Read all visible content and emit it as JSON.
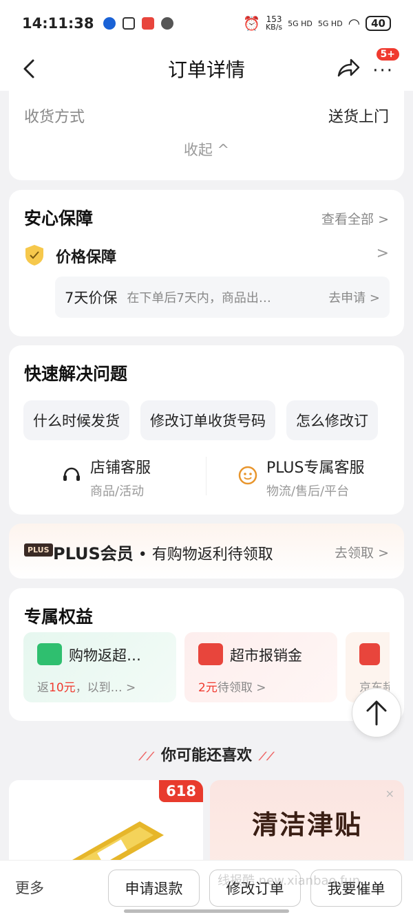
{
  "status_bar": {
    "time": "14:11:38",
    "net_speed_value": "153",
    "net_speed_unit": "KB/s",
    "sim1": "5G HD",
    "sim2": "5G HD",
    "battery": "40"
  },
  "nav": {
    "title": "订单详情",
    "badge": "5+",
    "more": "···"
  },
  "delivery": {
    "label": "收货方式",
    "value": "送货上门",
    "collapse": "收起 ^"
  },
  "guarantee": {
    "title": "安心保障",
    "view_all": "查看全部 >",
    "item_title": "价格保障",
    "chevron": ">",
    "sub_name": "7天价保",
    "sub_desc": "在下单后7天内，商品出…",
    "sub_action": "去申请 >"
  },
  "quick": {
    "title": "快速解决问题",
    "chips": [
      "什么时候发货",
      "修改订单收货号码",
      "怎么修改订"
    ],
    "store_service": {
      "name": "店铺客服",
      "sub": "商品/活动"
    },
    "plus_service": {
      "name": "PLUS专属客服",
      "sub": "物流/售后/平台"
    }
  },
  "plus": {
    "tag": "PLUS",
    "brand": "PLUS会员",
    "text": " • 有购物返利待领取",
    "action": "去领取 >"
  },
  "benefits": {
    "title": "专属权益",
    "items": [
      {
        "title": "购物返超…",
        "sub_prefix": "返",
        "sub_amount": "10元",
        "sub_suffix": "，以到… >"
      },
      {
        "title": "超市报销金",
        "sub_prefix": "",
        "sub_amount": "2元",
        "sub_suffix": "待领取 >"
      },
      {
        "title": "",
        "sub": "京东超"
      }
    ]
  },
  "may_like": {
    "title": "你可能还喜欢"
  },
  "products": [
    {
      "tag": "618"
    },
    {
      "promo": "清洁津贴",
      "close": "×"
    }
  ],
  "watermark": "线报酷 new.xianbao.fun",
  "bottom": {
    "more": "更多",
    "refund": "申请退款",
    "modify": "修改订单",
    "urge": "我要催单"
  },
  "colors": {
    "accent_red": "#f03a2f",
    "plus_dark": "#3a2a25",
    "green_icon": "#2fbf6f"
  }
}
